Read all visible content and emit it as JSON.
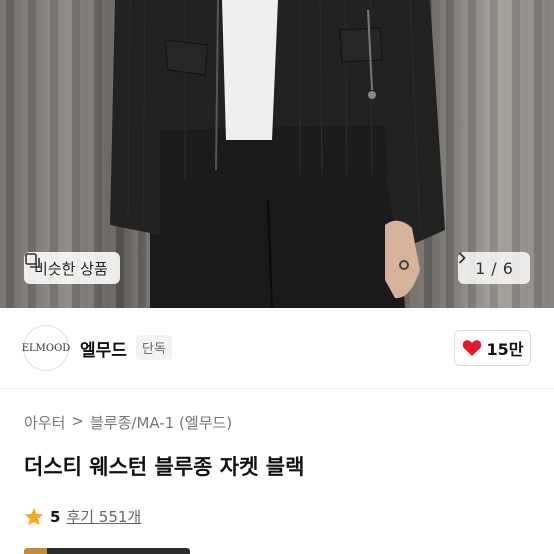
{
  "gallery": {
    "similar_label": "비슷한 상품",
    "current": "1",
    "separator": "/",
    "total": "6"
  },
  "shop": {
    "logo_text": "ELMOOD",
    "name": "엘무드",
    "badge": "단독",
    "likes": "15만"
  },
  "product": {
    "breadcrumbs": [
      "아우터",
      ">",
      "블루종/MA-1 (엘무드)"
    ],
    "title": "더스티 웨스턴 블루종 자켓 블랙",
    "rating": "5",
    "reviews_label": "후기 551개"
  },
  "colors": {
    "heart": "#e6192c",
    "star": "#f5a623"
  }
}
